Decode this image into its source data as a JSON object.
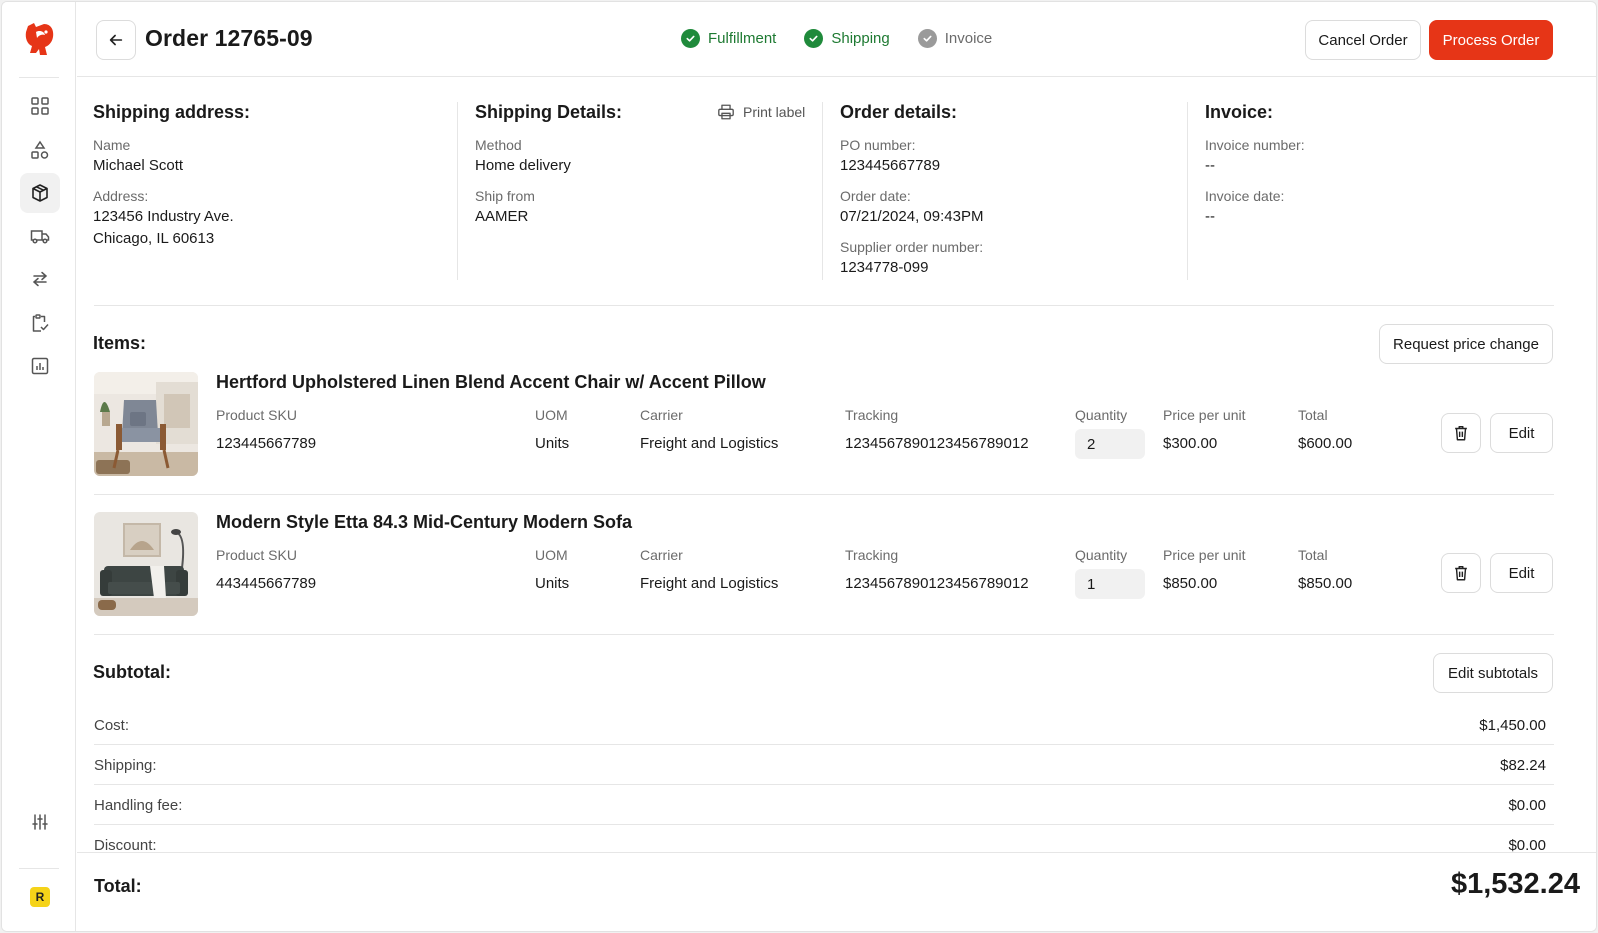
{
  "header": {
    "order_title": "Order 12765-09",
    "steps": [
      {
        "label": "Fulfillment",
        "state": "done"
      },
      {
        "label": "Shipping",
        "state": "done"
      },
      {
        "label": "Invoice",
        "state": "pending"
      }
    ],
    "cancel_label": "Cancel Order",
    "process_label": "Process Order"
  },
  "colors": {
    "brand": "#e63517",
    "success": "#1f8a3b",
    "muted": "#9a9a9a"
  },
  "sidebar": {
    "items": [
      {
        "icon": "grid-icon"
      },
      {
        "icon": "shapes-icon"
      },
      {
        "icon": "box-icon",
        "active": true
      },
      {
        "icon": "truck-icon"
      },
      {
        "icon": "transfer-icon"
      },
      {
        "icon": "clipboard-check-icon"
      },
      {
        "icon": "report-icon"
      }
    ],
    "bottom_icon": "sliders-icon",
    "avatar_letter": "R"
  },
  "shipping_address": {
    "title": "Shipping address:",
    "name_label": "Name",
    "name": "Michael Scott",
    "address_label": "Address:",
    "address_line1": "123456 Industry Ave.",
    "address_line2": "Chicago, IL 60613"
  },
  "shipping_details": {
    "title": "Shipping Details:",
    "print_label": "Print label",
    "method_label": "Method",
    "method": "Home delivery",
    "ship_from_label": "Ship from",
    "ship_from": "AAMER"
  },
  "order_details": {
    "title": "Order details:",
    "po_label": "PO number:",
    "po": "123445667789",
    "date_label": "Order date:",
    "date": "07/21/2024, 09:43PM",
    "supplier_label": "Supplier order number:",
    "supplier": "1234778-099"
  },
  "invoice": {
    "title": "Invoice:",
    "number_label": "Invoice number:",
    "number": "--",
    "date_label": "Invoice date:",
    "date": "--"
  },
  "items_section": {
    "title": "Items:",
    "request_price_label": "Request price change",
    "col_sku": "Product SKU",
    "col_uom": "UOM",
    "col_carrier": "Carrier",
    "col_tracking": "Tracking",
    "col_quantity": "Quantity",
    "col_price": "Price per unit",
    "col_total": "Total",
    "edit_label": "Edit",
    "items": [
      {
        "name": "Hertford Upholstered Linen Blend Accent Chair w/ Accent Pillow",
        "sku": "123445667789",
        "uom": "Units",
        "carrier": "Freight and Logistics",
        "tracking": "1234567890123456789012",
        "quantity": "2",
        "price": "$300.00",
        "total": "$600.00"
      },
      {
        "name": "Modern Style Etta 84.3 Mid-Century Modern Sofa",
        "sku": "443445667789",
        "uom": "Units",
        "carrier": "Freight and Logistics",
        "tracking": "1234567890123456789012",
        "quantity": "1",
        "price": "$850.00",
        "total": "$850.00"
      }
    ]
  },
  "subtotal": {
    "title": "Subtotal:",
    "edit_label": "Edit subtotals",
    "rows": [
      {
        "label": "Cost:",
        "value": "$1,450.00"
      },
      {
        "label": "Shipping:",
        "value": "$82.24"
      },
      {
        "label": "Handling fee:",
        "value": "$0.00"
      },
      {
        "label": "Discount:",
        "value": "$0.00"
      }
    ],
    "total_label": "Total:",
    "total_value": "$1,532.24"
  }
}
